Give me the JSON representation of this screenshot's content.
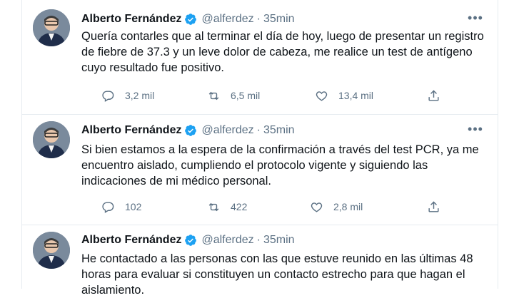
{
  "tweets": [
    {
      "name": "Alberto Fernández",
      "handle": "@alferdez",
      "separator": "·",
      "time": "35min",
      "text": "Quería contarles que al terminar el día de hoy, luego de presentar un registro de fiebre de 37.3 y un leve dolor de cabeza, me realice un test de antígeno cuyo resultado fue positivo.",
      "replies": "3,2 mil",
      "retweets": "6,5 mil",
      "likes": "13,4 mil"
    },
    {
      "name": "Alberto Fernández",
      "handle": "@alferdez",
      "separator": "·",
      "time": "35min",
      "text": "Si bien estamos a la espera de la confirmación a través del test PCR, ya me encuentro aislado, cumpliendo el protocolo vigente y siguiendo las indicaciones de mi médico personal.",
      "replies": "102",
      "retweets": "422",
      "likes": "2,8 mil"
    },
    {
      "name": "Alberto Fernández",
      "handle": "@alferdez",
      "separator": "·",
      "time": "35min",
      "text": "He contactado a las personas con las que estuve reunido en las últimas 48 horas para evaluar si constituyen un contacto estrecho para que hagan el aislamiento.",
      "replies": "",
      "retweets": "",
      "likes": ""
    }
  ],
  "icons": {
    "more": "more-icon",
    "reply": "reply-icon",
    "retweet": "retweet-icon",
    "like": "heart-icon",
    "share": "share-icon",
    "verified": "verified-badge-icon"
  },
  "colors": {
    "text": "#0f1419",
    "muted": "#5b7083",
    "verified": "#1da1f2",
    "border": "#e6ecf0"
  }
}
